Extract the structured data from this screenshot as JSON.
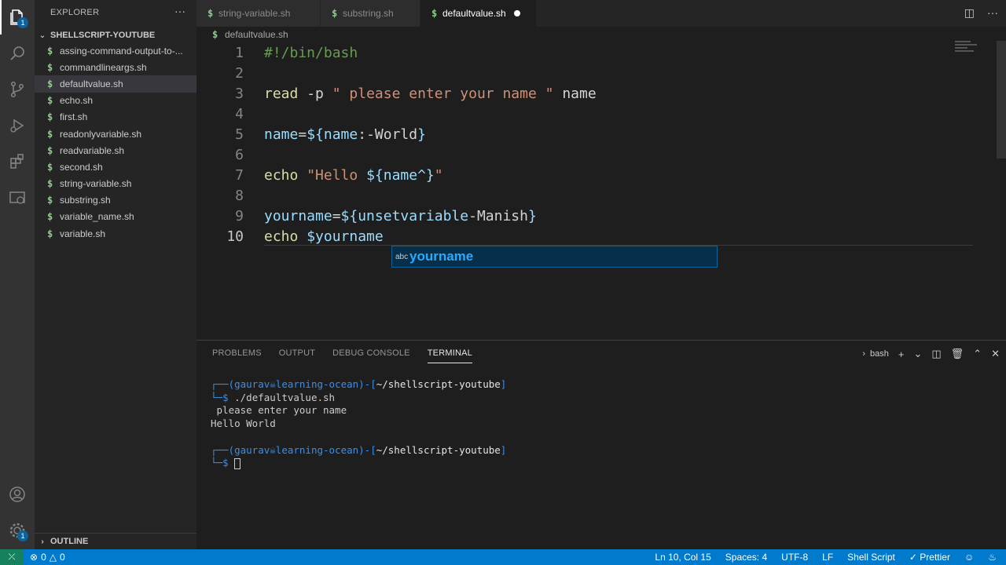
{
  "sidebar": {
    "title": "EXPLORER",
    "more": "···",
    "folder": "SHELLSCRIPT-YOUTUBE",
    "files": [
      {
        "name": "assing-command-output-to-..."
      },
      {
        "name": "commandlineargs.sh"
      },
      {
        "name": "defaultvalue.sh"
      },
      {
        "name": "echo.sh"
      },
      {
        "name": "first.sh"
      },
      {
        "name": "readonlyvariable.sh"
      },
      {
        "name": "readvariable.sh"
      },
      {
        "name": "second.sh"
      },
      {
        "name": "string-variable.sh"
      },
      {
        "name": "substring.sh"
      },
      {
        "name": "variable_name.sh"
      },
      {
        "name": "variable.sh"
      }
    ],
    "outline": "OUTLINE",
    "explorer_badge": "1",
    "settings_badge": "1"
  },
  "tabs": [
    {
      "label": "string-variable.sh"
    },
    {
      "label": "substring.sh"
    },
    {
      "label": "defaultvalue.sh"
    }
  ],
  "breadcrumb": "defaultvalue.sh",
  "editor": {
    "line_numbers": [
      "1",
      "2",
      "3",
      "4",
      "5",
      "6",
      "7",
      "8",
      "9",
      "10"
    ],
    "suggestion": "yourname",
    "suggestion_icon": "abc"
  },
  "panel": {
    "tabs": [
      "PROBLEMS",
      "OUTPUT",
      "DEBUG CONSOLE",
      "TERMINAL"
    ],
    "shell": "bash",
    "terminal": {
      "user": "gaurav",
      "host": "learning-ocean",
      "path": "~/shellscript-youtube",
      "command": "./defaultvalue.sh",
      "output1": " please enter your name",
      "output2": "Hello World"
    }
  },
  "status": {
    "errors": "0",
    "warnings": "0",
    "position": "Ln 10, Col 15",
    "spaces": "Spaces: 4",
    "encoding": "UTF-8",
    "eol": "LF",
    "language": "Shell Script",
    "formatter": "Prettier"
  }
}
